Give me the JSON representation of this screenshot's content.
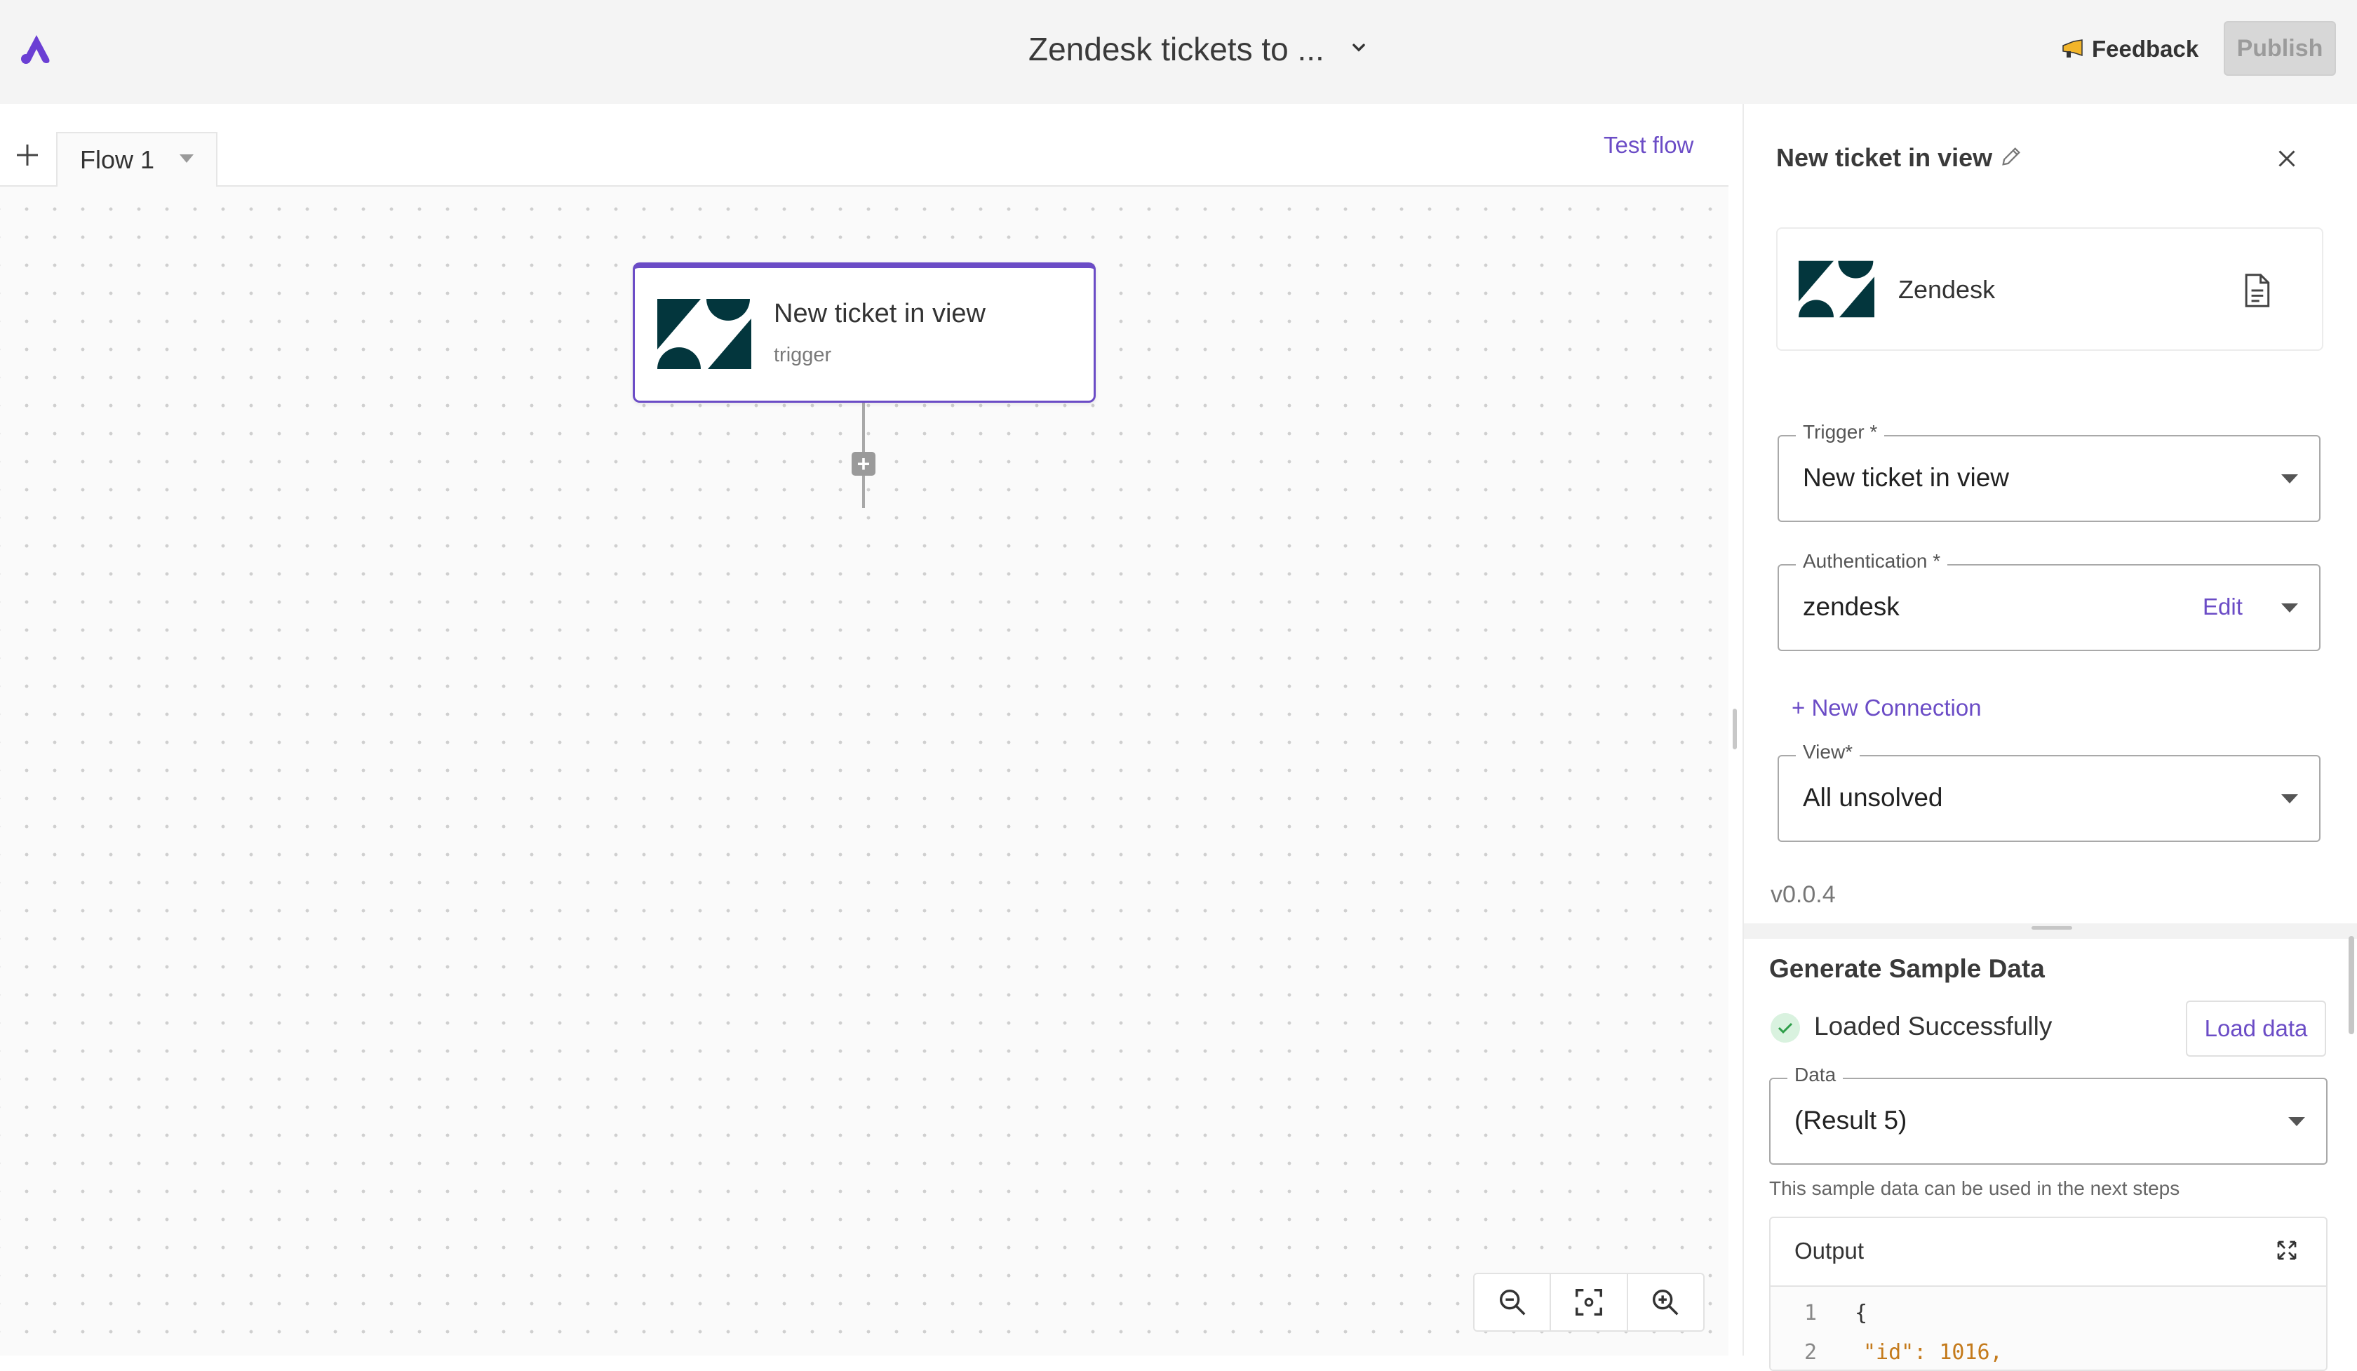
{
  "header": {
    "title": "Zendesk tickets to ...",
    "feedback_label": "Feedback",
    "publish_label": "Publish"
  },
  "canvas": {
    "flow_tab_label": "Flow 1",
    "test_flow_label": "Test flow",
    "node": {
      "title": "New ticket in view",
      "subtitle": "trigger"
    }
  },
  "panel": {
    "title": "New ticket in view",
    "piece_name": "Zendesk",
    "trigger": {
      "label": "Trigger *",
      "value": "New ticket in view"
    },
    "auth": {
      "label": "Authentication *",
      "value": "zendesk",
      "edit_label": "Edit"
    },
    "new_connection_label": "+ New Connection",
    "view": {
      "label": "View*",
      "value": "All unsolved"
    },
    "version": "v0.0.4"
  },
  "sample": {
    "title": "Generate Sample Data",
    "status": "Loaded Successfully",
    "load_button": "Load data",
    "data": {
      "label": "Data",
      "value": "(Result 5)"
    },
    "hint": "This sample data can be used in the next steps",
    "output_title": "Output",
    "code_lines": [
      {
        "num": "1",
        "text": "{"
      },
      {
        "num": "2",
        "text": "\"id\": 1016,"
      }
    ]
  },
  "colors": {
    "accent": "#6b4cc6",
    "zendesk": "#03363d",
    "success": "#2e9e49"
  },
  "icons": [
    "app-logo-icon",
    "chevron-down-icon",
    "megaphone-icon",
    "plus-icon",
    "zendesk-icon",
    "pencil-icon",
    "close-icon",
    "document-icon",
    "check-icon",
    "expand-icon",
    "zoom-out-icon",
    "fit-view-icon",
    "zoom-in-icon"
  ]
}
